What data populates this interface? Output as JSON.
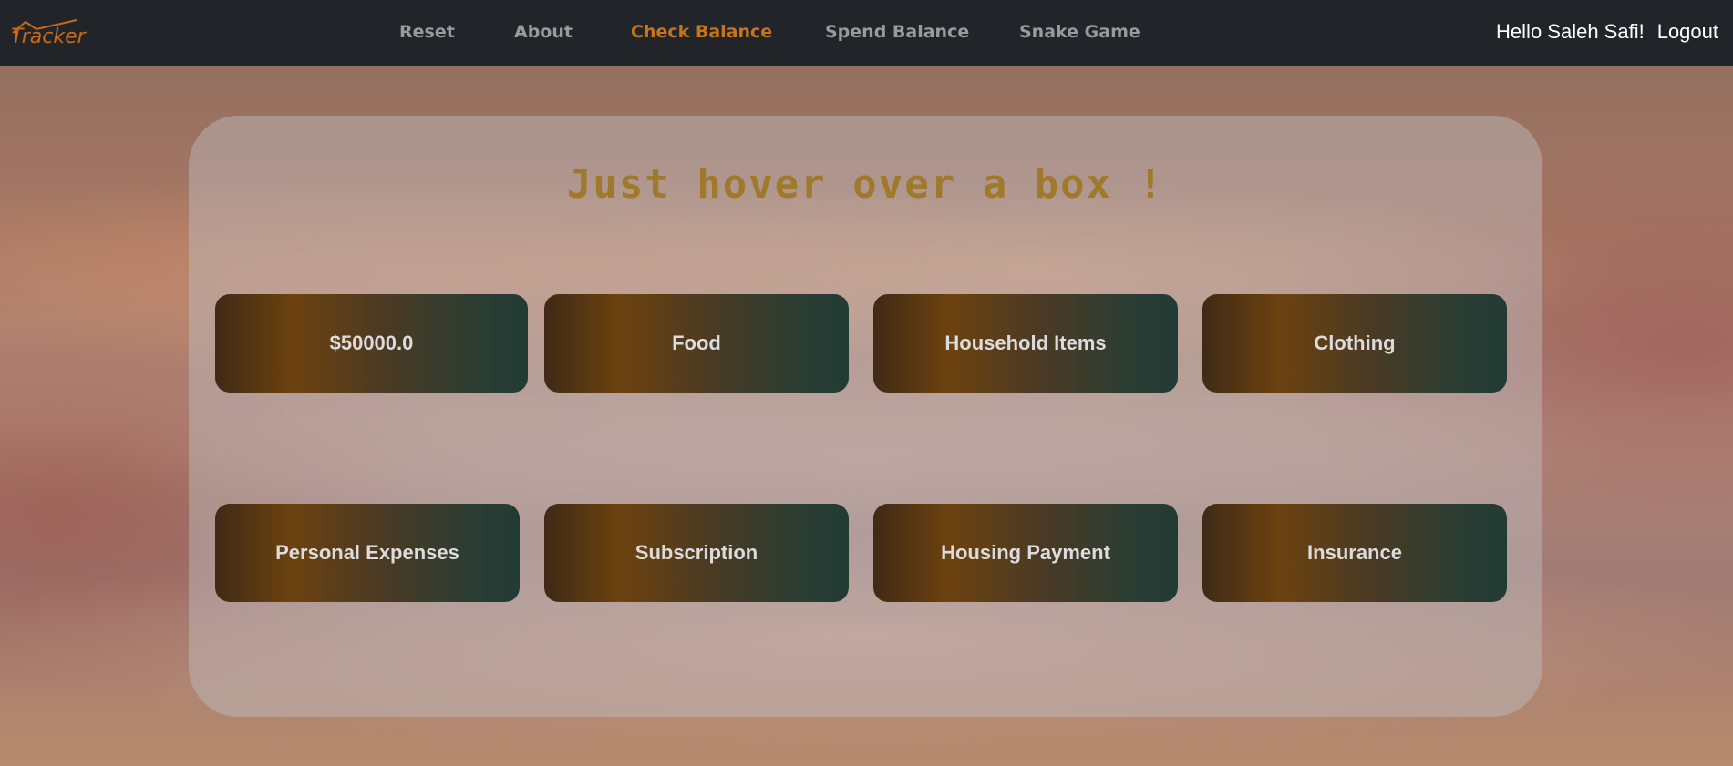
{
  "navbar": {
    "brand": "Tracker",
    "links": [
      {
        "label": "Reset",
        "active": false
      },
      {
        "label": "About",
        "active": false
      },
      {
        "label": "Check Balance",
        "active": true
      },
      {
        "label": "Spend Balance",
        "active": false
      },
      {
        "label": "Snake Game",
        "active": false
      }
    ],
    "greeting": "Hello Saleh Safi!",
    "logout": "Logout"
  },
  "main": {
    "headline": "Just hover over a box !",
    "boxes": [
      {
        "label": "$50000.0"
      },
      {
        "label": "Food"
      },
      {
        "label": "Household Items"
      },
      {
        "label": "Clothing"
      },
      {
        "label": "Personal Expenses"
      },
      {
        "label": "Subscription"
      },
      {
        "label": "Housing Payment"
      },
      {
        "label": "Insurance"
      }
    ]
  },
  "colors": {
    "navbar_bg": "#212529",
    "brand": "#c76a16",
    "nav_link": "#9a9a9a",
    "nav_active": "#c8741c",
    "headline": "#a07a2a",
    "box_text": "#dcdcdc"
  }
}
